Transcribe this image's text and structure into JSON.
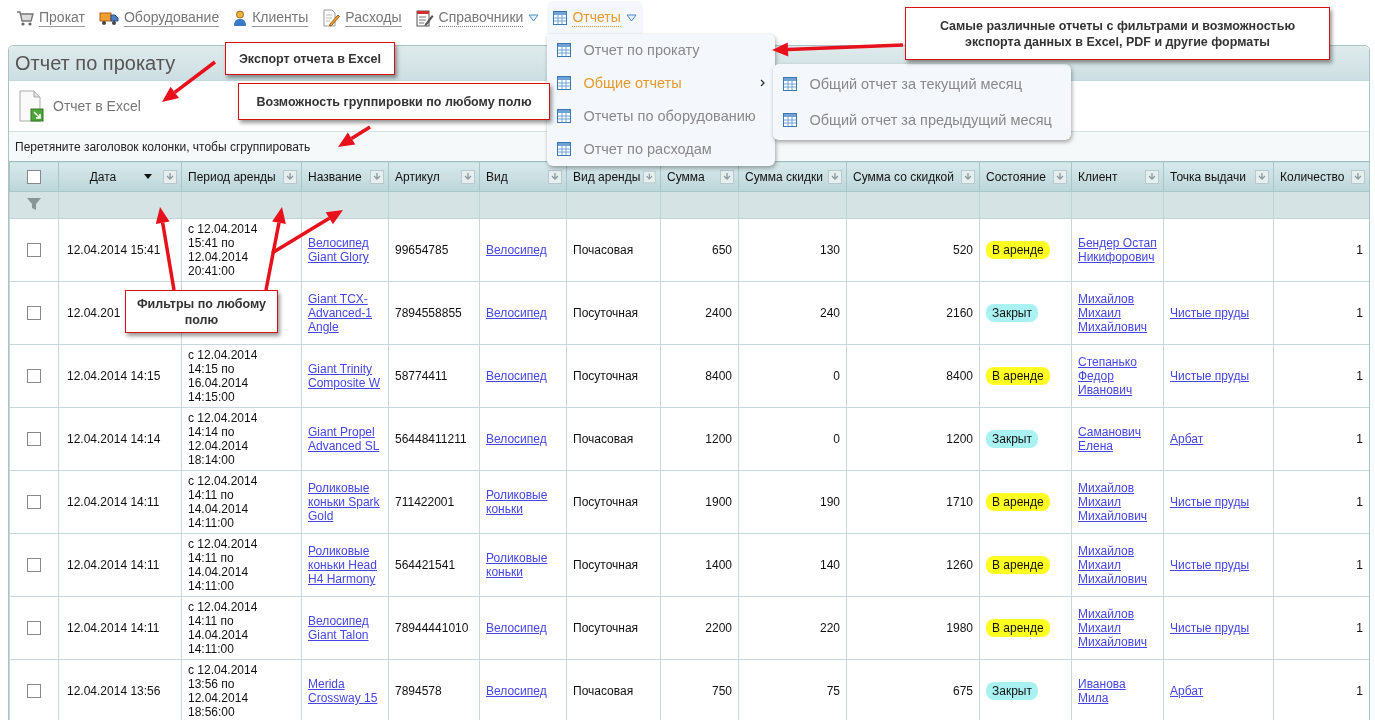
{
  "nav": [
    {
      "label": "Прокат",
      "dropdown": false,
      "expanded": false
    },
    {
      "label": "Оборудование",
      "dropdown": false,
      "expanded": false
    },
    {
      "label": "Клиенты",
      "dropdown": false,
      "expanded": false
    },
    {
      "label": "Расходы",
      "dropdown": false,
      "expanded": false
    },
    {
      "label": "Справочники",
      "dropdown": true,
      "expanded": false
    },
    {
      "label": "Отчеты",
      "dropdown": true,
      "expanded": true,
      "menu": [
        {
          "label": "Отчет по прокату",
          "highlighted": false
        },
        {
          "label": "Общие отчеты",
          "highlighted": true,
          "submenu": [
            {
              "label": "Общий отчет за текущий месяц"
            },
            {
              "label": "Общий отчет за предыдущий месяц"
            }
          ]
        },
        {
          "label": "Отчеты по оборудованию",
          "highlighted": false
        },
        {
          "label": "Отчет по расходам",
          "highlighted": false
        }
      ]
    }
  ],
  "panel": {
    "title": "Отчет по прокату",
    "toolbar": [
      {
        "label": "Отчет в Excel"
      }
    ],
    "group_hint": "Перетяните заголовок колонки, чтобы сгруппировать"
  },
  "table": {
    "select_all_checked": false,
    "columns": [
      {
        "label": "Дата",
        "sorted": true
      },
      {
        "label": "Период аренды",
        "sorted": false
      },
      {
        "label": "Название",
        "sorted": false
      },
      {
        "label": "Артикул",
        "sorted": false
      },
      {
        "label": "Вид",
        "sorted": false
      },
      {
        "label": "Вид аренды",
        "sorted": false
      },
      {
        "label": "Сумма",
        "sorted": false
      },
      {
        "label": "Сумма скидки",
        "sorted": false
      },
      {
        "label": "Сумма со скидкой",
        "sorted": false
      },
      {
        "label": "Состояние",
        "sorted": false
      },
      {
        "label": "Клиент",
        "sorted": false
      },
      {
        "label": "Точка выдачи",
        "sorted": false
      },
      {
        "label": "Количество",
        "sorted": false
      }
    ],
    "rows": [
      {
        "checked": false,
        "date": "12.04.2014 15:41",
        "period": "с 12.04.2014 15:41 по 12.04.2014 20:41:00",
        "name": "Велосипед Giant Glory",
        "article": "99654785",
        "type": "Велосипед",
        "rent_type": "Почасовая",
        "sum": "650",
        "discount": "130",
        "total": "520",
        "status": {
          "label": "В аренде",
          "color": "#ffff22"
        },
        "client": "Бендер Остап Никифорович",
        "quantity": "1"
      },
      {
        "checked": false,
        "date": "12.04.201",
        "name": "Giant TCX-Advanced-1 Angle",
        "article": "7894558855",
        "type": "Велосипед",
        "rent_type": "Посуточная",
        "sum": "2400",
        "discount": "240",
        "total": "2160",
        "status": {
          "label": "Закрыт",
          "color": "#aaf2f2"
        },
        "client": "Михайлов Михаил Михайлович",
        "point": "Чистые пруды",
        "quantity": "1"
      },
      {
        "checked": false,
        "date": "12.04.2014 14:15",
        "period": "с 12.04.2014 14:15 по 16.04.2014 14:15:00",
        "name": "Giant Trinity Composite W",
        "article": "58774411",
        "type": "Велосипед",
        "rent_type": "Посуточная",
        "sum": "8400",
        "discount": "0",
        "total": "8400",
        "status": {
          "label": "В аренде",
          "color": "#ffff22"
        },
        "client": "Степанько Федор Иванович",
        "point": "Чистые пруды",
        "quantity": "1"
      },
      {
        "checked": false,
        "date": "12.04.2014 14:14",
        "period": "с 12.04.2014 14:14 по 12.04.2014 18:14:00",
        "name": "Giant Propel Advanced SL",
        "article": "56448411211",
        "type": "Велосипед",
        "rent_type": "Почасовая",
        "sum": "1200",
        "discount": "0",
        "total": "1200",
        "status": {
          "label": "Закрыт",
          "color": "#aaf2f2"
        },
        "client": "Саманович Елена",
        "point": "Арбат",
        "quantity": "1"
      },
      {
        "checked": false,
        "date": "12.04.2014 14:11",
        "period": "с 12.04.2014 14:11 по 14.04.2014 14:11:00",
        "name": "Роликовые коньки Spark Gold",
        "article": "711422001",
        "type": "Роликовые коньки",
        "rent_type": "Посуточная",
        "sum": "1900",
        "discount": "190",
        "total": "1710",
        "status": {
          "label": "В аренде",
          "color": "#ffff22"
        },
        "client": "Михайлов Михаил Михайлович",
        "point": "Чистые пруды",
        "quantity": "1"
      },
      {
        "checked": false,
        "date": "12.04.2014 14:11",
        "period": "с 12.04.2014 14:11 по 14.04.2014 14:11:00",
        "name": "Роликовые коньки Head H4 Harmony",
        "article": "564421541",
        "type": "Роликовые коньки",
        "rent_type": "Посуточная",
        "sum": "1400",
        "discount": "140",
        "total": "1260",
        "status": {
          "label": "В аренде",
          "color": "#ffff22"
        },
        "client": "Михайлов Михаил Михайлович",
        "point": "Чистые пруды",
        "quantity": "1"
      },
      {
        "checked": false,
        "date": "12.04.2014 14:11",
        "period": "с 12.04.2014 14:11 по 14.04.2014 14:11:00",
        "name": "Велосипед Giant Talon",
        "article": "78944441010",
        "type": "Велосипед",
        "rent_type": "Посуточная",
        "sum": "2200",
        "discount": "220",
        "total": "1980",
        "status": {
          "label": "В аренде",
          "color": "#ffff22"
        },
        "client": "Михайлов Михаил Михайлович",
        "point": "Чистые пруды",
        "quantity": "1"
      },
      {
        "checked": false,
        "date": "12.04.2014 13:56",
        "period": "с 12.04.2014 13:56 по 12.04.2014 18:56:00",
        "name": "Merida Crossway 15",
        "article": "7894578",
        "type": "Велосипед",
        "rent_type": "Почасовая",
        "sum": "750",
        "discount": "75",
        "total": "675",
        "status": {
          "label": "Закрыт",
          "color": "#aaf2f2"
        },
        "client": "Иванова Мила",
        "point": "Арбат",
        "quantity": "1"
      }
    ]
  },
  "annotations": [
    {
      "text": "Самые различные отчеты с фильтрами и возможностью экспорта данных в Excel, PDF и другие форматы"
    },
    {
      "text": "Экспорт отчета в Excel"
    },
    {
      "text": "Возможность группировки по любому полю"
    },
    {
      "text": "Фильтры по любому полю"
    }
  ]
}
